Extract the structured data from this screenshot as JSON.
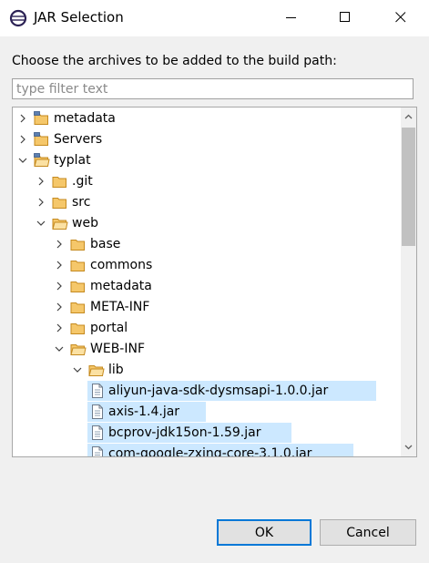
{
  "window": {
    "title": "JAR Selection",
    "icon": "eclipse-icon",
    "controls": [
      "minimize-icon",
      "maximize-icon",
      "close-icon"
    ]
  },
  "prompt": "Choose the archives to be added to the build path:",
  "filter": {
    "placeholder": "type filter text",
    "value": ""
  },
  "tree": {
    "rows": [
      {
        "label": "metadata",
        "type": "project",
        "expanded": false,
        "depth": 0
      },
      {
        "label": "Servers",
        "type": "project",
        "expanded": false,
        "depth": 0
      },
      {
        "label": "typlat",
        "type": "project",
        "expanded": true,
        "depth": 0
      },
      {
        "label": ".git",
        "type": "folder",
        "expanded": false,
        "depth": 1
      },
      {
        "label": "src",
        "type": "folder",
        "expanded": false,
        "depth": 1
      },
      {
        "label": "web",
        "type": "folder",
        "expanded": true,
        "depth": 1
      },
      {
        "label": "base",
        "type": "folder",
        "expanded": false,
        "depth": 2
      },
      {
        "label": "commons",
        "type": "folder",
        "expanded": false,
        "depth": 2
      },
      {
        "label": "metadata",
        "type": "folder",
        "expanded": false,
        "depth": 2
      },
      {
        "label": "META-INF",
        "type": "folder",
        "expanded": false,
        "depth": 2
      },
      {
        "label": "portal",
        "type": "folder",
        "expanded": false,
        "depth": 2
      },
      {
        "label": "WEB-INF",
        "type": "folder",
        "expanded": true,
        "depth": 2
      },
      {
        "label": "lib",
        "type": "folder",
        "expanded": true,
        "depth": 3
      },
      {
        "label": "aliyun-java-sdk-dysmsapi-1.0.0.jar",
        "type": "jar",
        "selected": true,
        "depth": 4
      },
      {
        "label": "axis-1.4.jar",
        "type": "jar",
        "selected": true,
        "depth": 4
      },
      {
        "label": "bcprov-jdk15on-1.59.jar",
        "type": "jar",
        "selected": true,
        "depth": 4
      },
      {
        "label": "com-google-zxing-core-3.1.0.jar",
        "type": "jar",
        "selected": true,
        "depth": 4
      }
    ]
  },
  "buttons": {
    "ok": "OK",
    "cancel": "Cancel"
  },
  "colors": {
    "selection": "#cce8ff",
    "folder": "#e8a33d",
    "accent": "#0078d7"
  }
}
